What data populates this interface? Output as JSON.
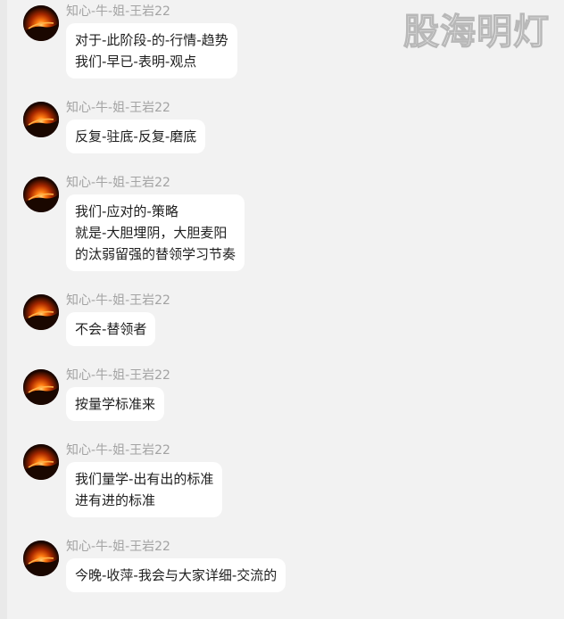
{
  "watermark": {
    "text": "股海明灯"
  },
  "messages": [
    {
      "sender": "知心-牛-姐-王岩22",
      "lines": [
        "对于-此阶段-的-行情-趋势",
        "我们-早已-表明-观点"
      ]
    },
    {
      "sender": "知心-牛-姐-王岩22",
      "lines": [
        "反复-驻底-反复-磨底"
      ]
    },
    {
      "sender": "知心-牛-姐-王岩22",
      "lines": [
        "我们-应对的-策略",
        "就是-大胆埋阴，大胆麦阳",
        "的汰弱留强的替领学习节奏"
      ]
    },
    {
      "sender": "知心-牛-姐-王岩22",
      "lines": [
        "不会-替领者"
      ]
    },
    {
      "sender": "知心-牛-姐-王岩22",
      "lines": [
        "按量学标准来"
      ]
    },
    {
      "sender": "知心-牛-姐-王岩22",
      "lines": [
        "我们量学-出有出的标准",
        "进有进的标准"
      ]
    },
    {
      "sender": "知心-牛-姐-王岩22",
      "lines": [
        "今晚-收萍-我会与大家详细-交流的"
      ]
    }
  ],
  "colors": {
    "background": "#f2f2f2",
    "bubble": "#ffffff",
    "sender_text": "#a3a3a3",
    "message_text": "#1e1e1e",
    "avatar_glow": "#ff6a00"
  },
  "icons": {
    "avatar": "sunset-avatar-icon"
  }
}
